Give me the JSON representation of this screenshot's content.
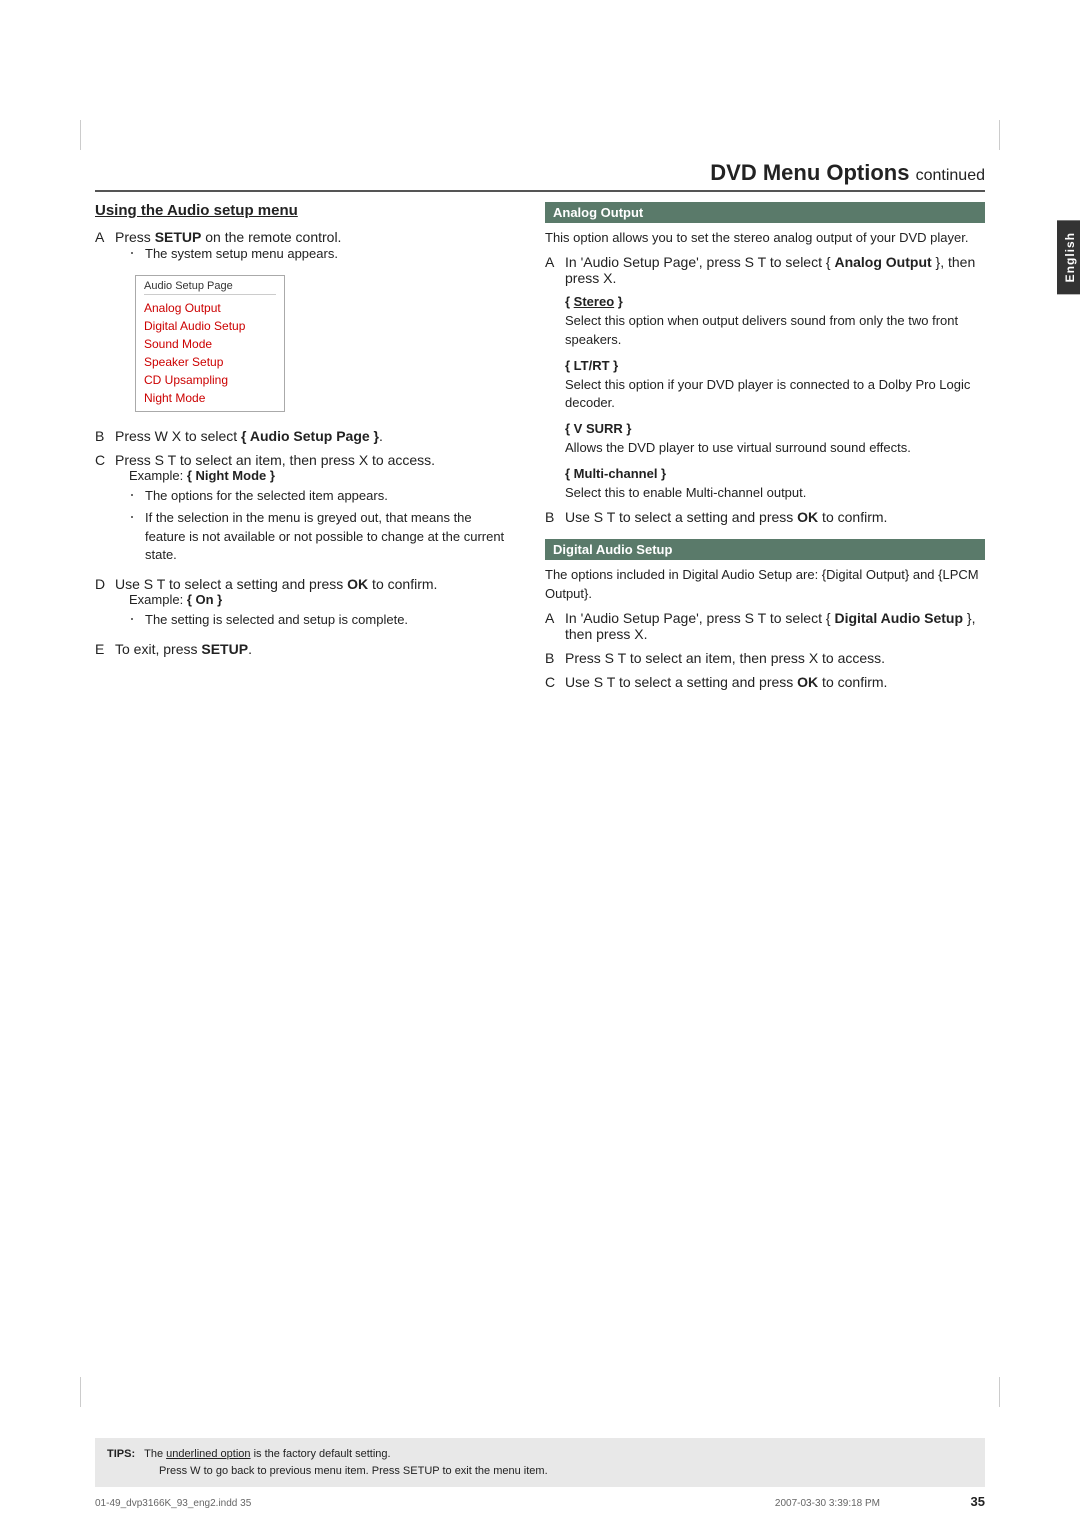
{
  "page": {
    "title": "DVD Menu Options",
    "title_continued": "continued",
    "page_number": "35",
    "footer_left": "01-49_dvp3166K_93_eng2.indd  35",
    "footer_right": "2007-03-30  3:39:18 PM"
  },
  "side_tab": {
    "label": "English"
  },
  "left_section": {
    "heading": "Using the Audio setup menu",
    "step_a_label": "A",
    "step_a_text": "Press ",
    "step_a_bold": "SETUP",
    "step_a_rest": " on the remote control.",
    "step_a_sub": "The system setup menu appears.",
    "menu_header": "Audio Setup Page",
    "menu_items": [
      "Analog Output",
      "Digital Audio Setup",
      "Sound Mode",
      "Speaker Setup",
      "CD Upsampling",
      "Night Mode"
    ],
    "step_b_label": "B",
    "step_b_text": "Press W X to select ",
    "step_b_bold": "{ Audio Setup Page }",
    "step_c_label": "C",
    "step_c_text": "Press S T to select an item, then press X to access.",
    "step_c_example_label": "Example: ",
    "step_c_example": "{ Night Mode }",
    "bullet1": "The options for the selected item appears.",
    "bullet2": "If the selection in the menu is greyed out, that means the feature is not available or not possible to change at the current state.",
    "step_d_label": "D",
    "step_d_text": "Use S T to select a setting and press ",
    "step_d_bold": "OK",
    "step_d_rest": " to confirm.",
    "step_d_example_label": "Example: ",
    "step_d_example": "{ On }",
    "bullet3": "The setting is selected and setup is complete.",
    "step_e_label": "E",
    "step_e_text": "To exit, press ",
    "step_e_bold": "SETUP",
    "step_e_rest": "."
  },
  "right_section": {
    "analog_bar": "Analog Output",
    "analog_intro": "This option allows you to set the stereo analog output of your DVD player.",
    "analog_step_a_label": "A",
    "analog_step_a_text": "In 'Audio Setup Page', press S T to select { ",
    "analog_step_a_bold": "Analog Output",
    "analog_step_a_rest": " }, then press X.",
    "stereo_heading": "{ Stereo }",
    "stereo_text": "Select this option when output delivers sound from only the two front speakers.",
    "ltrt_heading": "{ LT/RT }",
    "ltrt_text": "Select this option if your DVD player is connected to a Dolby Pro Logic decoder.",
    "vsurr_heading": "{ V SURR }",
    "vsurr_text": "Allows the DVD player to use virtual surround sound effects.",
    "multichannel_heading": "{ Multi-channel }",
    "multichannel_text": "Select this to enable Multi-channel output.",
    "analog_step_b_label": "B",
    "analog_step_b_text": "Use S T to select a setting and press ",
    "analog_step_b_bold": "OK",
    "analog_step_b_rest": " to confirm.",
    "digital_bar": "Digital Audio Setup",
    "digital_intro": "The options included in Digital Audio Setup are: {Digital Output} and {LPCM Output}.",
    "digital_step_a_label": "A",
    "digital_step_a_text": "In 'Audio Setup Page', press S T to select { ",
    "digital_step_a_bold": "Digital Audio Setup",
    "digital_step_a_rest": " }, then press X.",
    "digital_step_b_label": "B",
    "digital_step_b_text": "Press S T to select an item, then press X to access.",
    "digital_step_c_label": "C",
    "digital_step_c_text": "Use S T to select a setting and press ",
    "digital_step_c_bold": "OK",
    "digital_step_c_rest": " to confirm."
  },
  "tips": {
    "label": "TIPS:",
    "line1_pre": "The ",
    "line1_underline": "underlined option",
    "line1_post": " is the factory default setting.",
    "line2": "Press  W to go back to previous menu item. Press SETUP to exit the menu item."
  }
}
